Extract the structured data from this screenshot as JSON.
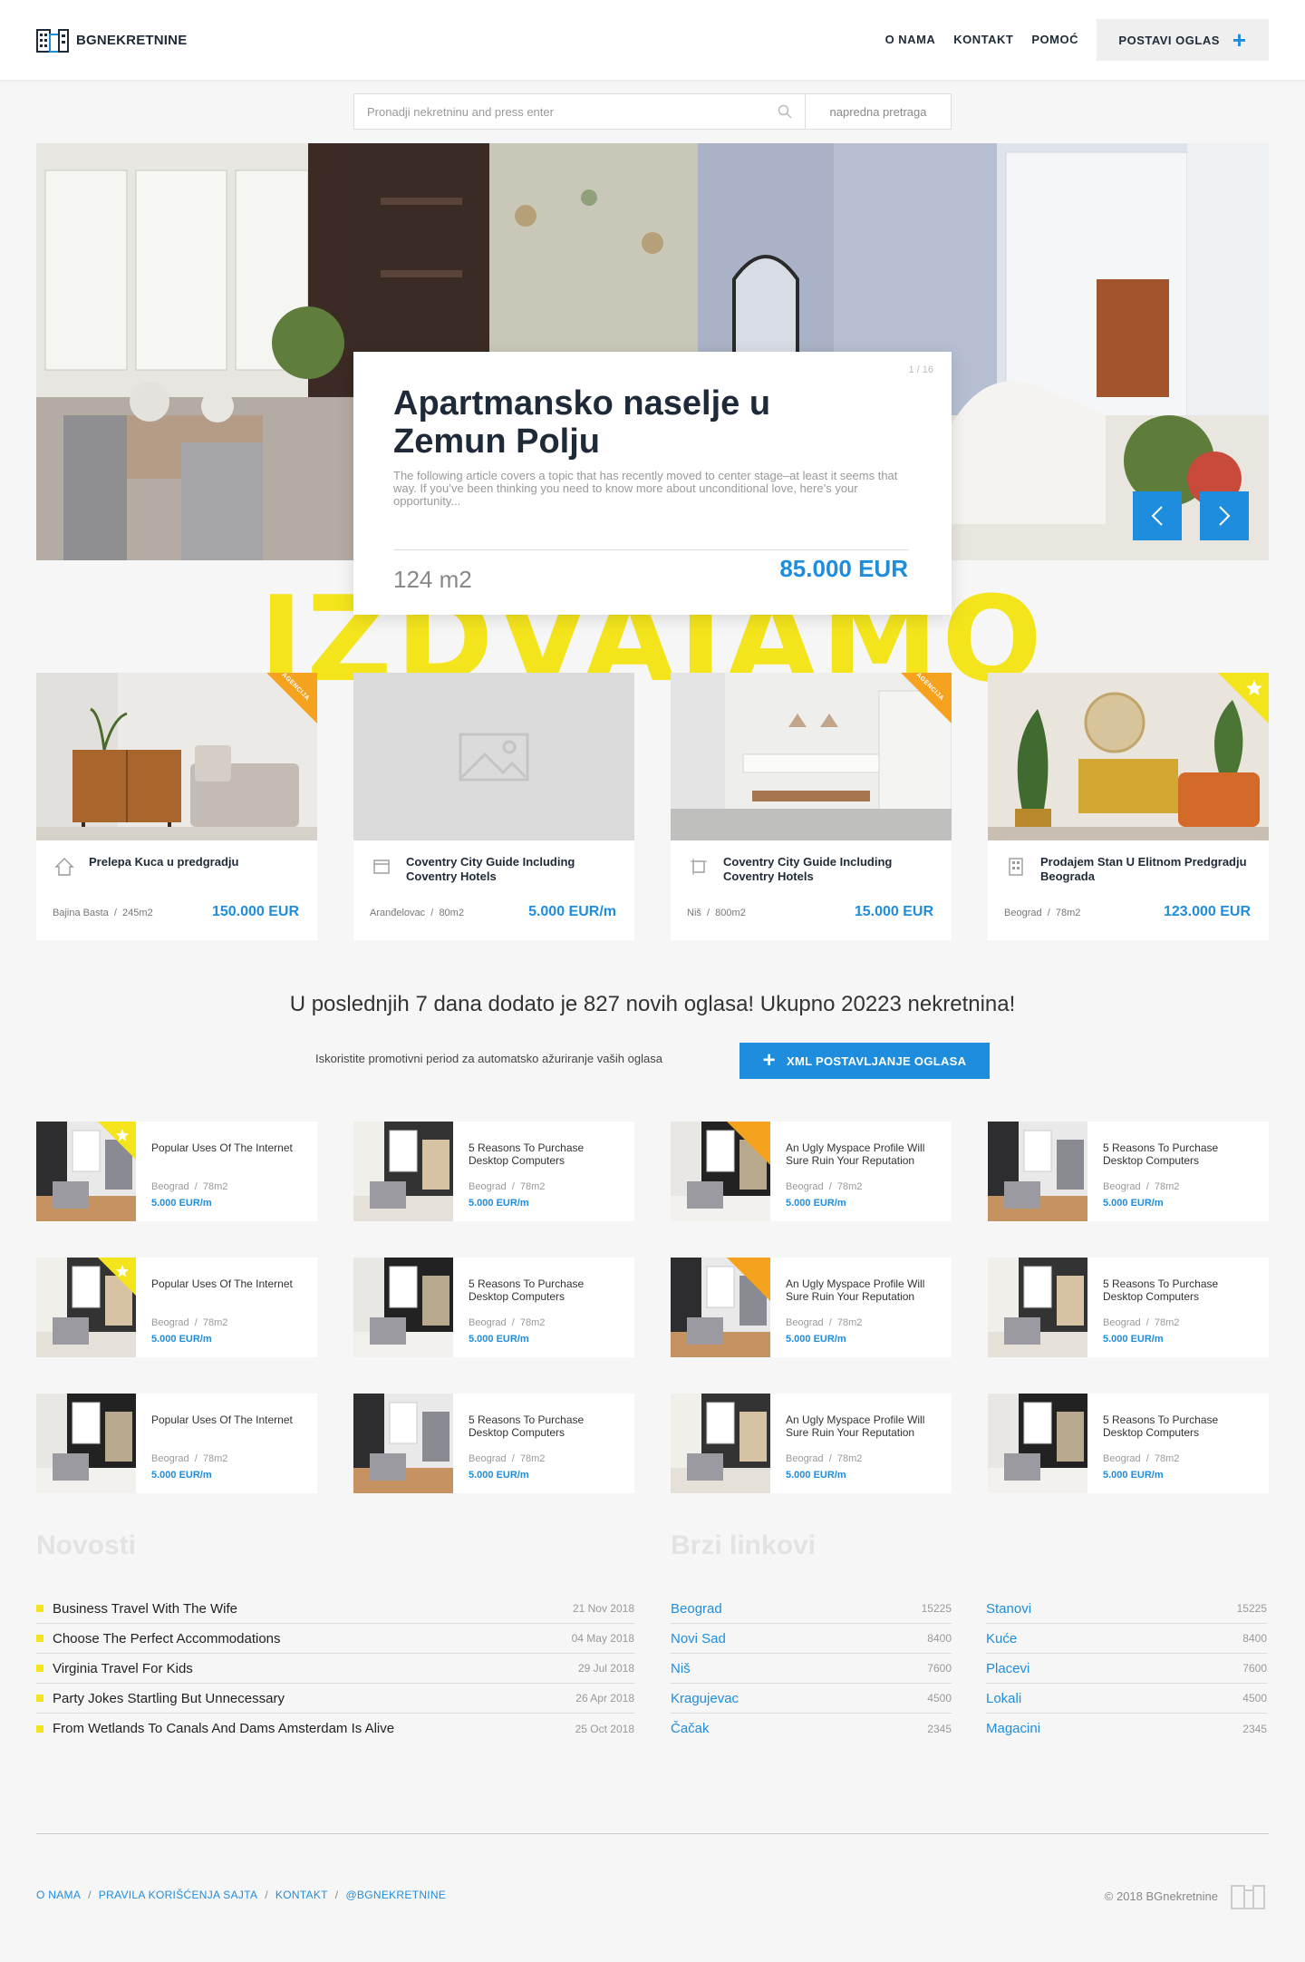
{
  "header": {
    "logo_text": "BGNEKRETNINE",
    "nav": [
      "O NAMA",
      "KONTAKT",
      "POMOĆ"
    ],
    "post_label": "POSTAVI OGLAS"
  },
  "search": {
    "placeholder": "Pronadji nekretninu and press enter",
    "advanced_label": "napredna pretraga"
  },
  "hero": {
    "counter": "1 / 16",
    "title": "Apartmansko naselje u Zemun Polju",
    "description": "The following article covers a topic that has recently moved to center stage–at least it seems that way. If you’ve been thinking you need to know more about unconditional love, here’s your opportunity...",
    "area": "124 m2",
    "price": "85.000 EUR"
  },
  "featured_heading": "IZDVAJAMO",
  "featured": [
    {
      "title": "Prelepa Kuca u predgradju",
      "location": "Bajina Basta",
      "size": "245m2",
      "price": "150.000 EUR",
      "badge": "AGENCIJA",
      "icon": "house-icon"
    },
    {
      "title": "Coventry City Guide Including Coventry Hotels",
      "location": "Aranđelovac",
      "size": "80m2",
      "price": "5.000 EUR/m",
      "badge": "",
      "icon": "flat-icon"
    },
    {
      "title": "Coventry City Guide Including Coventry Hotels",
      "location": "Niš",
      "size": "800m2",
      "price": "15.000 EUR",
      "badge": "AGENCIJA",
      "icon": "plot-icon"
    },
    {
      "title": "Prodajem Stan U Elitnom Predgradju Beograda",
      "location": "Beograd",
      "size": "78m2",
      "price": "123.000 EUR",
      "badge": "star",
      "icon": "building-icon"
    }
  ],
  "stats_text": "U poslednjih 7 dana dodato je 827 novih oglasa! Ukupno 20223 nekretnina!",
  "promo_text": "Iskoristite promotivni period za automatsko ažuriranje vaših oglasa",
  "xml_label": "XML POSTAVLJANJE OGLASA",
  "listings": [
    {
      "title": "Popular Uses Of The Internet",
      "location": "Beograd",
      "size": "78m2",
      "price": "5.000 EUR/m",
      "badge": "star"
    },
    {
      "title": "5 Reasons To Purchase Desktop Computers",
      "location": "Beograd",
      "size": "78m2",
      "price": "5.000 EUR/m",
      "badge": ""
    },
    {
      "title": "An Ugly Myspace Profile Will Sure Ruin Your Reputation",
      "location": "Beograd",
      "size": "78m2",
      "price": "5.000 EUR/m",
      "badge": "AGENCIJA"
    },
    {
      "title": "5 Reasons To Purchase Desktop Computers",
      "location": "Beograd",
      "size": "78m2",
      "price": "5.000 EUR/m",
      "badge": ""
    },
    {
      "title": "Popular Uses Of The Internet",
      "location": "Beograd",
      "size": "78m2",
      "price": "5.000 EUR/m",
      "badge": "star"
    },
    {
      "title": "5 Reasons To Purchase Desktop Computers",
      "location": "Beograd",
      "size": "78m2",
      "price": "5.000 EUR/m",
      "badge": ""
    },
    {
      "title": "An Ugly Myspace Profile Will Sure Ruin Your Reputation",
      "location": "Beograd",
      "size": "78m2",
      "price": "5.000 EUR/m",
      "badge": "AGENCIJA"
    },
    {
      "title": "5 Reasons To Purchase Desktop Computers",
      "location": "Beograd",
      "size": "78m2",
      "price": "5.000 EUR/m",
      "badge": ""
    },
    {
      "title": "Popular Uses Of The Internet",
      "location": "Beograd",
      "size": "78m2",
      "price": "5.000 EUR/m",
      "badge": ""
    },
    {
      "title": "5 Reasons To Purchase Desktop Computers",
      "location": "Beograd",
      "size": "78m2",
      "price": "5.000 EUR/m",
      "badge": ""
    },
    {
      "title": "An Ugly Myspace Profile Will Sure Ruin Your Reputation",
      "location": "Beograd",
      "size": "78m2",
      "price": "5.000 EUR/m",
      "badge": ""
    },
    {
      "title": "5 Reasons To Purchase Desktop Computers",
      "location": "Beograd",
      "size": "78m2",
      "price": "5.000 EUR/m",
      "badge": ""
    }
  ],
  "news": {
    "title": "Novosti",
    "items": [
      {
        "title": "Business Travel With The Wife",
        "date": "21 Nov 2018"
      },
      {
        "title": "Choose The Perfect Accommodations",
        "date": "04 May 2018"
      },
      {
        "title": "Virginia Travel For Kids",
        "date": "29 Jul 2018"
      },
      {
        "title": "Party Jokes Startling But Unnecessary",
        "date": "26 Apr 2018"
      },
      {
        "title": "From Wetlands To Canals And Dams Amsterdam Is Alive",
        "date": "25 Oct 2018"
      }
    ]
  },
  "quick_links": {
    "title": "Brzi linkovi",
    "cities": [
      {
        "name": "Beograd",
        "count": "15225"
      },
      {
        "name": "Novi Sad",
        "count": "8400"
      },
      {
        "name": "Niš",
        "count": "7600"
      },
      {
        "name": "Kragujevac",
        "count": "4500"
      },
      {
        "name": "Čačak",
        "count": "2345"
      }
    ],
    "types": [
      {
        "name": "Stanovi",
        "count": "15225"
      },
      {
        "name": "Kuće",
        "count": "8400"
      },
      {
        "name": "Placevi",
        "count": "7600"
      },
      {
        "name": "Lokali",
        "count": "4500"
      },
      {
        "name": "Magacini",
        "count": "2345"
      }
    ]
  },
  "footer": {
    "links": [
      "O NAMA",
      "PRAVILA KORIŠĆENJA SAJTA",
      "KONTAKT",
      "@BGNEKRETNINE"
    ],
    "separator": "/",
    "copyright": "© 2018 BGnekretnine"
  },
  "colors": {
    "accent": "#1f8dde",
    "highlight": "#f3e41c",
    "badge": "#f5a21f"
  }
}
